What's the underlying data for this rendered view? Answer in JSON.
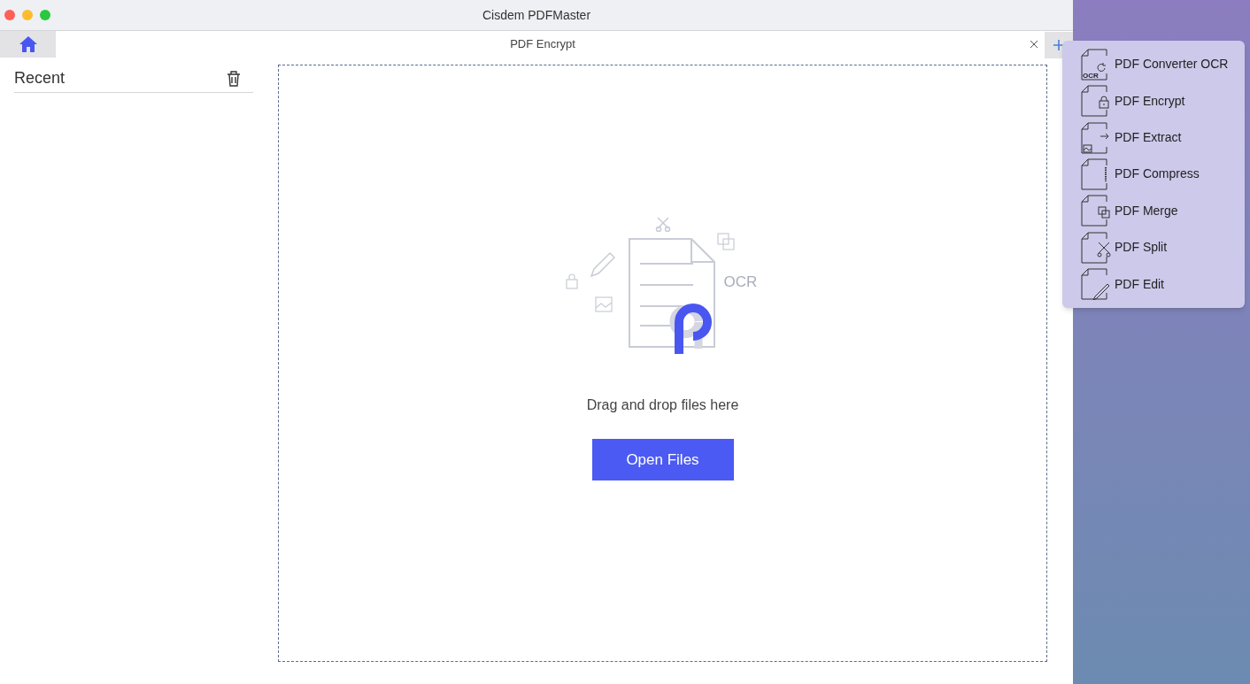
{
  "window": {
    "title": "Cisdem PDFMaster"
  },
  "tabs": [
    {
      "kind": "home",
      "selected": false
    },
    {
      "kind": "document",
      "label": "PDF Encrypt",
      "selected": true
    }
  ],
  "sidebar": {
    "title": "Recent"
  },
  "dropzone": {
    "illustration_label": "OCR",
    "message": "Drag and drop files here",
    "button": "Open Files"
  },
  "menu": {
    "items": [
      {
        "kind": "ocr",
        "label": "PDF Converter OCR",
        "icon_text": "OCR"
      },
      {
        "kind": "encrypt",
        "label": "PDF Encrypt"
      },
      {
        "kind": "extract",
        "label": "PDF Extract"
      },
      {
        "kind": "compress",
        "label": "PDF Compress"
      },
      {
        "kind": "merge",
        "label": "PDF Merge"
      },
      {
        "kind": "split",
        "label": "PDF Split"
      },
      {
        "kind": "edit",
        "label": "PDF Edit"
      }
    ]
  }
}
